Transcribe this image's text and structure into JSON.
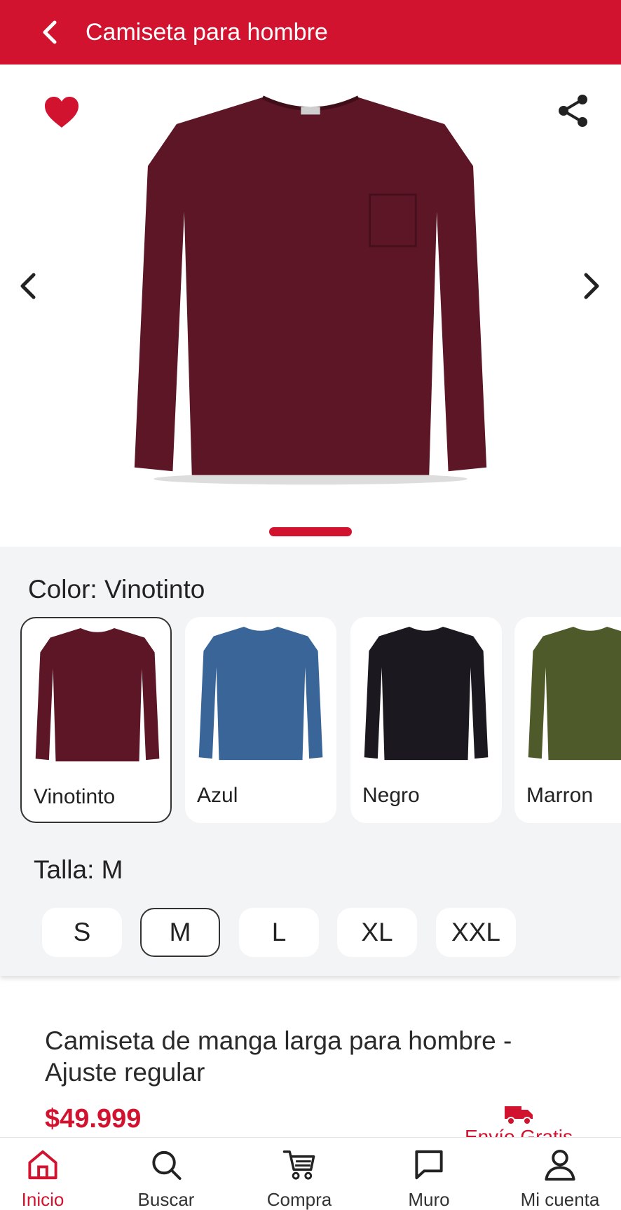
{
  "header": {
    "title": "Camiseta para hombre",
    "back_icon": "chevron-left-icon"
  },
  "gallery": {
    "favorite_icon": "heart-icon",
    "share_icon": "share-icon",
    "prev_icon": "chevron-left-icon",
    "next_icon": "chevron-right-icon",
    "image_color": "#5c1626"
  },
  "color": {
    "label": "Color:",
    "selected": "Vinotinto",
    "options": [
      {
        "name": "Vinotinto",
        "hex": "#5c1626"
      },
      {
        "name": "Azul",
        "hex": "#3a6598"
      },
      {
        "name": "Negro",
        "hex": "#1c1820"
      },
      {
        "name": "Marron",
        "hex": "#4f5a2a"
      }
    ]
  },
  "size": {
    "label": "Talla:",
    "selected": "M",
    "options": [
      "S",
      "M",
      "L",
      "XL",
      "XXL"
    ]
  },
  "product": {
    "title": "Camiseta de manga larga para hombre - Ajuste regular",
    "price": "$49.999",
    "shipping_icon": "delivery-truck-icon",
    "shipping_text": "Envío Gratis"
  },
  "nav": {
    "items": [
      {
        "label": "Inicio",
        "icon": "home-icon",
        "active": true
      },
      {
        "label": "Buscar",
        "icon": "search-icon",
        "active": false
      },
      {
        "label": "Compra",
        "icon": "cart-icon",
        "active": false
      },
      {
        "label": "Muro",
        "icon": "chat-icon",
        "active": false
      },
      {
        "label": "Mi cuenta",
        "icon": "user-icon",
        "active": false
      }
    ]
  },
  "colors": {
    "brand": "#d21330",
    "background_panel": "#f3f4f6"
  }
}
